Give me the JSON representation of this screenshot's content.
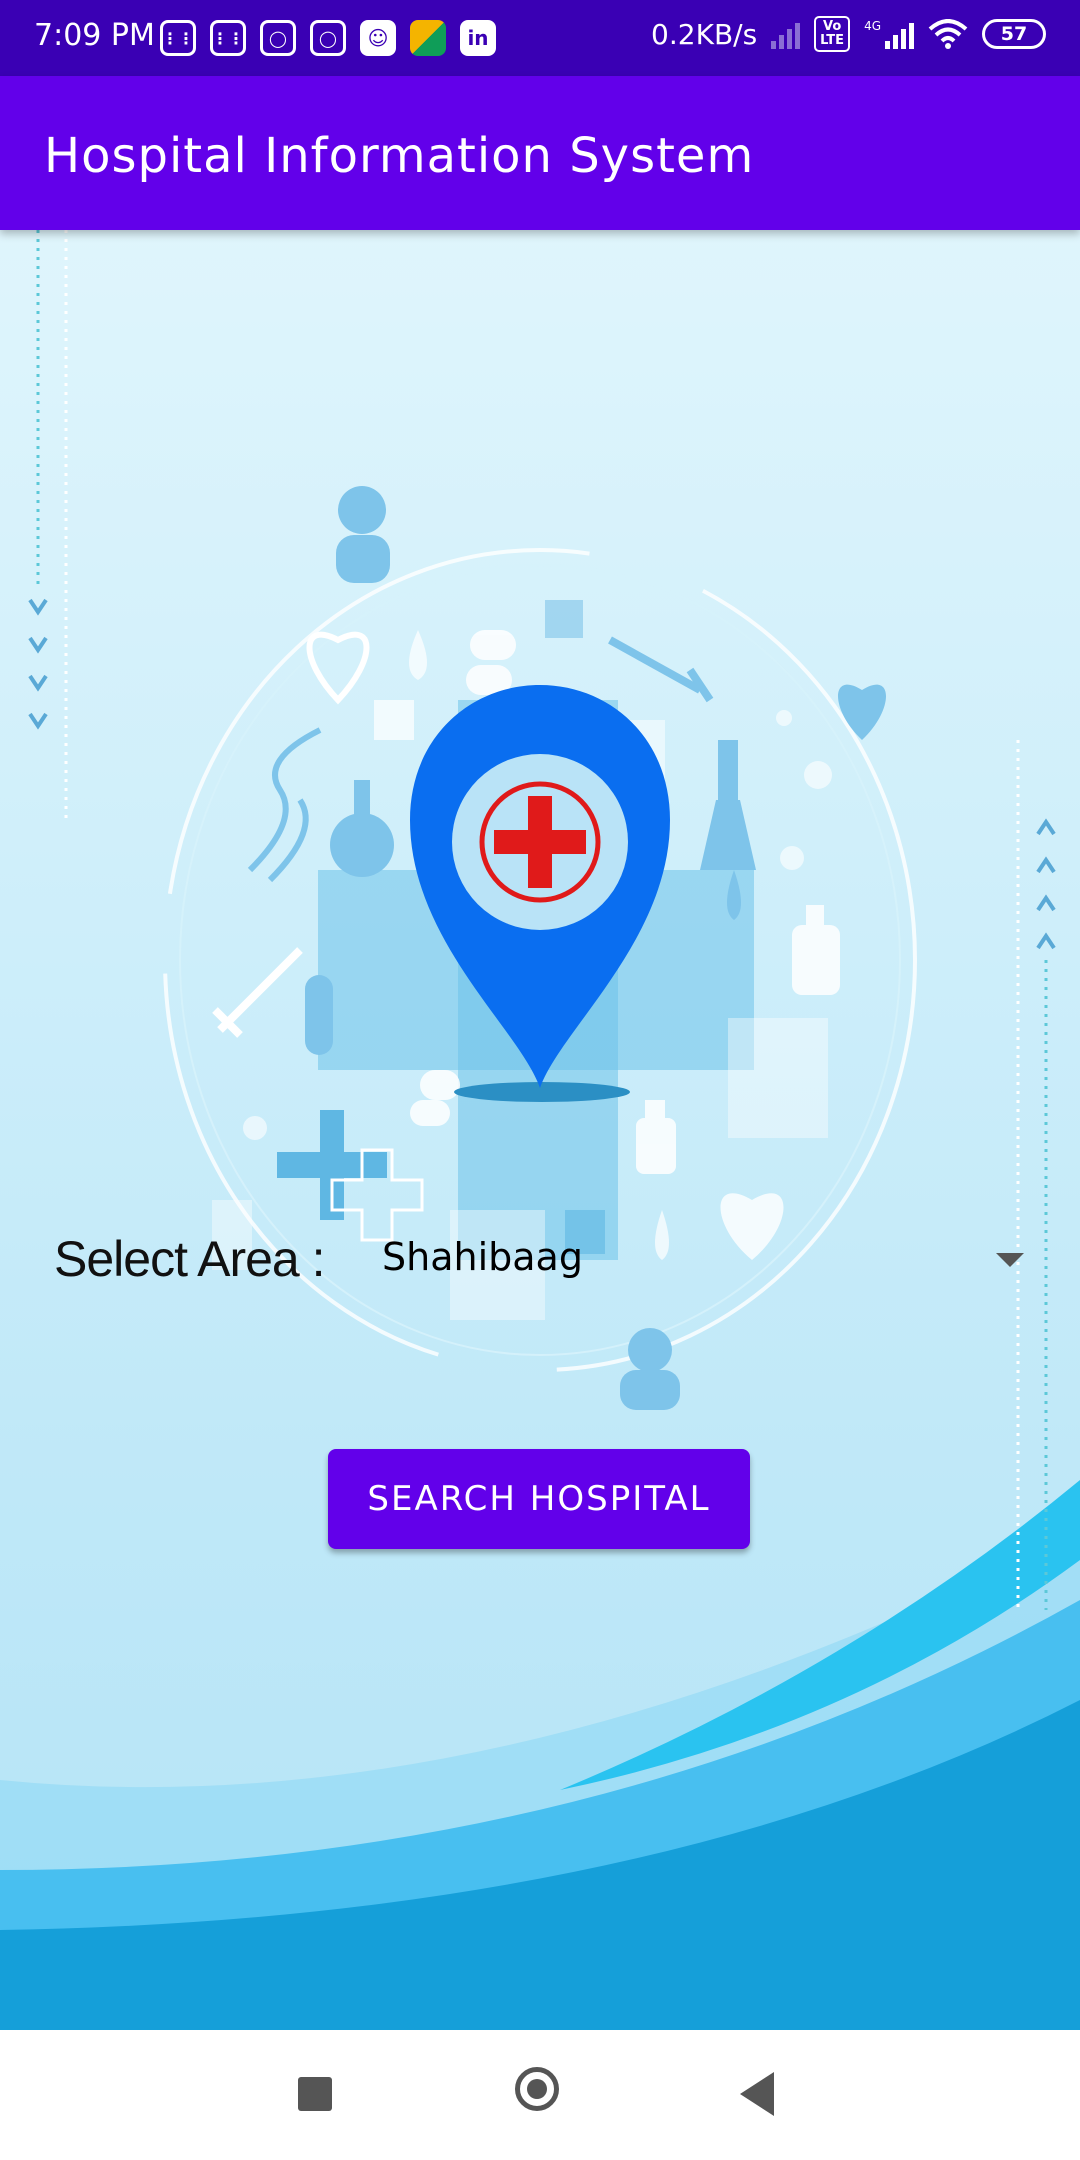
{
  "status_bar": {
    "time": "7:09 PM",
    "network_speed": "0.2KB/s",
    "volte": "Vo\nLTE",
    "network_type": "4G",
    "battery": "57",
    "apps": [
      "calculator-icon",
      "calculator-icon",
      "instagram-icon",
      "instagram-icon",
      "snapchat-icon",
      "slides-icon",
      "linkedin-icon"
    ]
  },
  "app_bar": {
    "title": "Hospital Information System"
  },
  "form": {
    "select_label": "Select Area :",
    "selected_area": "Shahibaag",
    "search_button": "SEARCH HOSPITAL"
  },
  "colors": {
    "status_bar": "#3a00b4",
    "app_bar": "#6200ea",
    "button": "#6200ea",
    "pin": "#0a6ef0",
    "cross": "#e01a1a"
  }
}
